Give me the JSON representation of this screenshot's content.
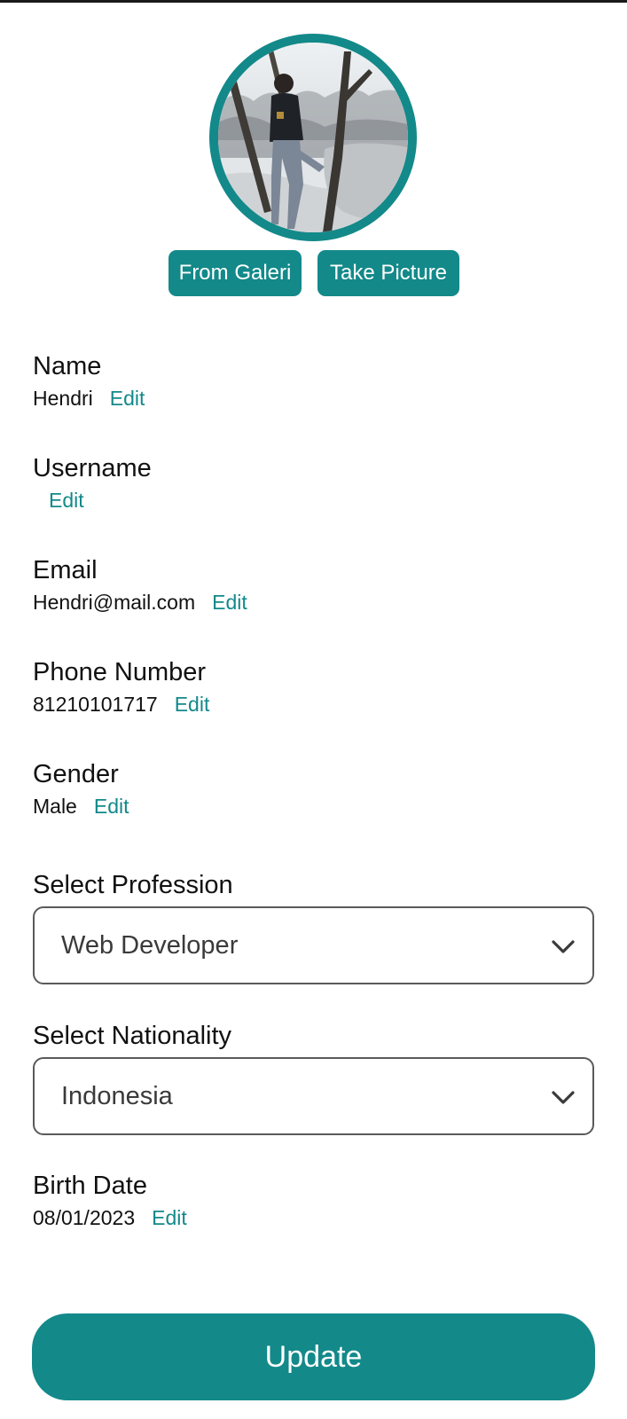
{
  "profile": {
    "from_gallery_label": "From Galeri",
    "take_picture_label": "Take Picture"
  },
  "fields": {
    "name": {
      "label": "Name",
      "value": "Hendri",
      "edit_label": "Edit"
    },
    "username": {
      "label": "Username",
      "value": "",
      "edit_label": "Edit"
    },
    "email": {
      "label": "Email",
      "value": "Hendri@mail.com",
      "edit_label": "Edit"
    },
    "phone": {
      "label": "Phone Number",
      "value": "81210101717",
      "edit_label": "Edit"
    },
    "gender": {
      "label": "Gender",
      "value": "Male",
      "edit_label": "Edit"
    },
    "birth_date": {
      "label": "Birth Date",
      "value": "08/01/2023",
      "edit_label": "Edit"
    }
  },
  "selects": {
    "profession": {
      "label": "Select Profession",
      "selected": "Web Developer"
    },
    "nationality": {
      "label": "Select Nationality",
      "selected": "Indonesia"
    }
  },
  "update_label": "Update",
  "colors": {
    "accent": "#13898a",
    "border": "#5a5a5a",
    "text": "#111111"
  }
}
